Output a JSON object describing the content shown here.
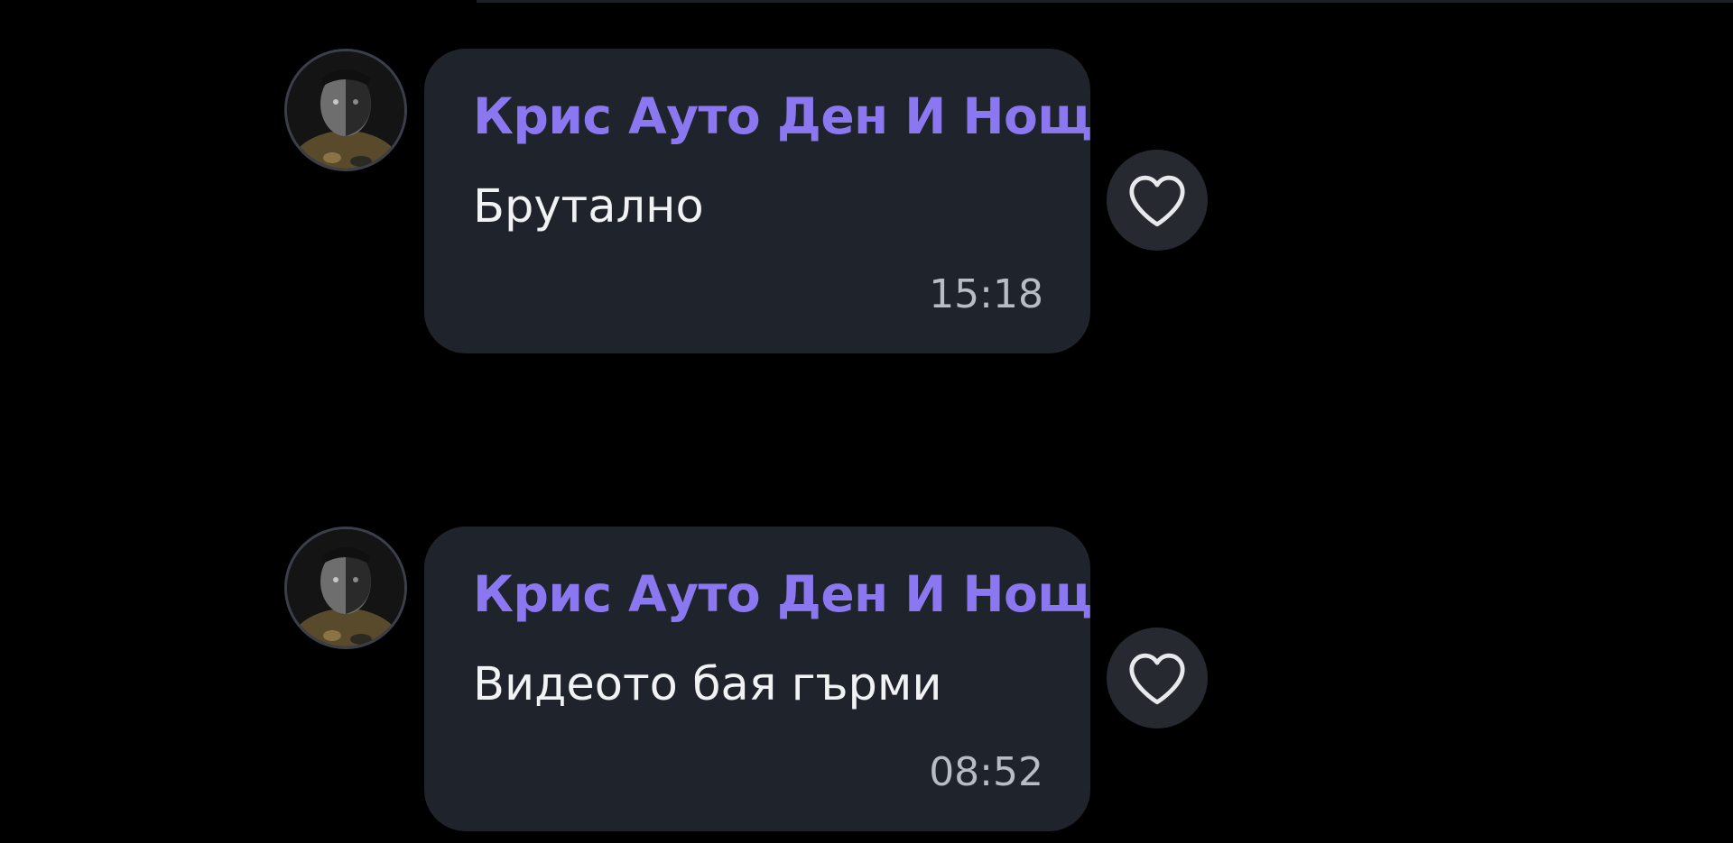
{
  "messages": [
    {
      "sender": "Крис Ауто Ден И Нощ",
      "text": "Брутално",
      "time": "15:18",
      "avatar_icon": "user-avatar",
      "like_icon": "heart-icon"
    },
    {
      "sender": "Крис Ауто Ден И Нощ",
      "text": "Видеото бая гърми",
      "time": "08:52",
      "avatar_icon": "user-avatar",
      "like_icon": "heart-icon"
    }
  ],
  "colors": {
    "background": "#000000",
    "bubble": "#1f232b",
    "sender": "#8b78f0",
    "text": "#f1f2f4",
    "time": "#b7bcc6",
    "like_button": "#262a30"
  }
}
